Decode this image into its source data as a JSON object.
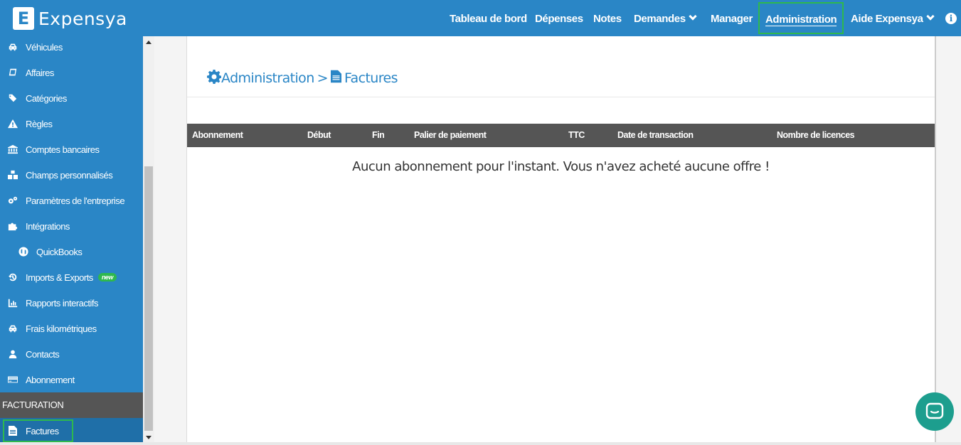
{
  "brand": {
    "name": "Expensya",
    "mark": "E"
  },
  "nav": {
    "items": [
      {
        "label": "Tableau de bord"
      },
      {
        "label": "Dépenses"
      },
      {
        "label": "Notes"
      },
      {
        "label": "Demandes"
      },
      {
        "label": "Manager"
      },
      {
        "label": "Administration"
      },
      {
        "label": "Aide Expensya"
      }
    ],
    "info_glyph": "i"
  },
  "sidebar": {
    "items": [
      {
        "label": "Véhicules",
        "icon": "car-icon"
      },
      {
        "label": "Affaires",
        "icon": "book-icon"
      },
      {
        "label": "Catégories",
        "icon": "tags-icon"
      },
      {
        "label": "Règles",
        "icon": "warning-icon"
      },
      {
        "label": "Comptes bancaires",
        "icon": "bank-icon"
      },
      {
        "label": "Champs personnalisés",
        "icon": "cubes-icon"
      },
      {
        "label": "Paramètres de l'entreprise",
        "icon": "gears-icon"
      },
      {
        "label": "Intégrations",
        "icon": "puzzle-icon"
      },
      {
        "label": "QuickBooks",
        "icon": "quickbooks-icon"
      },
      {
        "label": "Imports & Exports",
        "icon": "history-icon",
        "badge": "new"
      },
      {
        "label": "Rapports interactifs",
        "icon": "bar-chart-icon"
      },
      {
        "label": "Frais kilométriques",
        "icon": "car-icon"
      },
      {
        "label": "Contacts",
        "icon": "user-icon"
      },
      {
        "label": "Abonnement",
        "icon": "credit-card-icon"
      }
    ],
    "section_label": "FACTURATION",
    "active_item": {
      "label": "Factures",
      "icon": "file-icon"
    }
  },
  "main": {
    "breadcrumb": {
      "parent": "Administration",
      "separator": ">",
      "current": "Factures"
    },
    "table": {
      "headers": [
        "Abonnement",
        "Début",
        "Fin",
        "Palier de paiement",
        "TTC",
        "Date de transaction",
        "Nombre de licences"
      ]
    },
    "empty_message": "Aucun abonnement pour l'instant. Vous n'avez acheté aucune offre !"
  },
  "colors": {
    "primary": "#2a86c6",
    "highlight": "#2eb84e",
    "table_header": "#555555",
    "chat": "#1d9e8e"
  }
}
